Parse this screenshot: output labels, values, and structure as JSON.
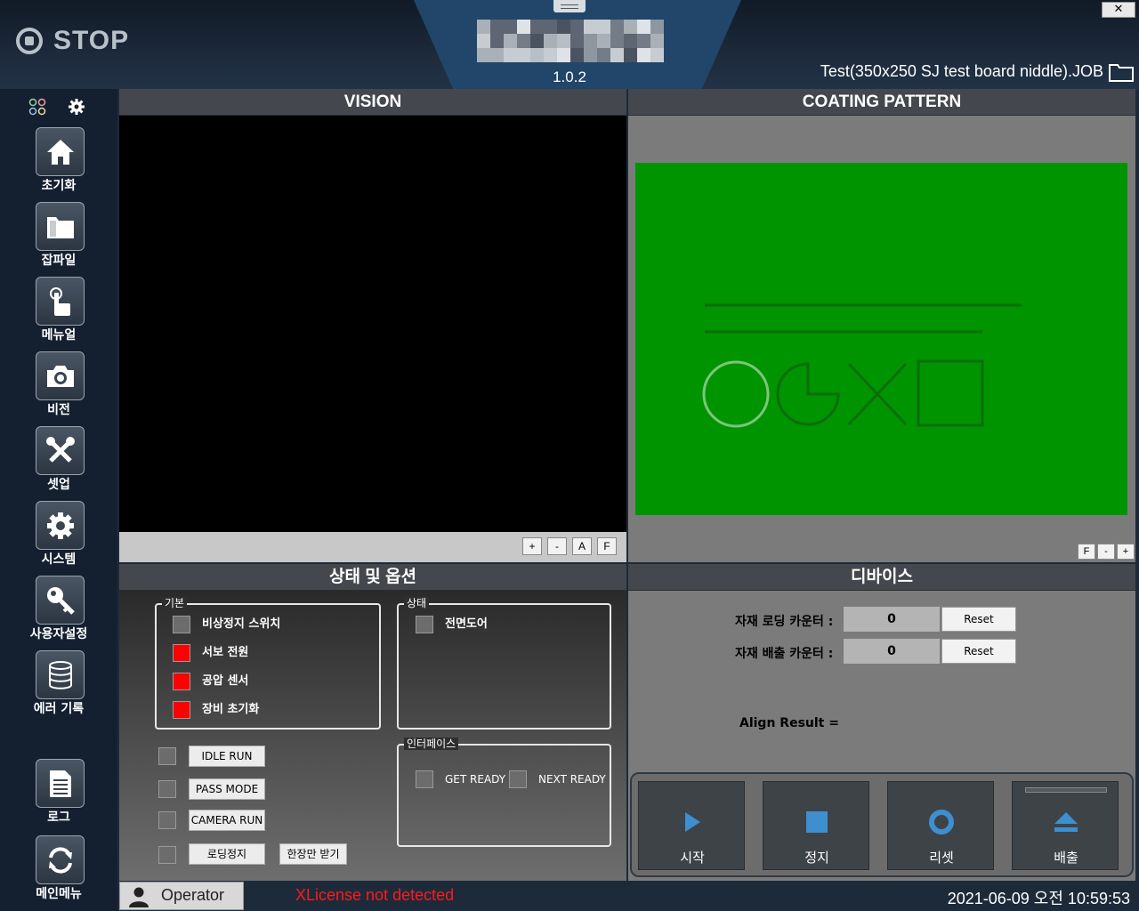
{
  "header": {
    "machine_state": "STOP",
    "version": "1.0.2",
    "job_file": "Test(350x250 SJ test board niddle).JOB",
    "close_label": "✕"
  },
  "sidebar": {
    "items": [
      {
        "label": "초기화",
        "icon": "home-icon"
      },
      {
        "label": "잡파일",
        "icon": "folder-icon"
      },
      {
        "label": "메뉴얼",
        "icon": "hand-pointer-icon"
      },
      {
        "label": "비전",
        "icon": "camera-icon"
      },
      {
        "label": "셋업",
        "icon": "tools-icon"
      },
      {
        "label": "시스템",
        "icon": "gear-icon"
      },
      {
        "label": "사용자설정",
        "icon": "key-icon"
      },
      {
        "label": "에러 기록",
        "icon": "database-icon"
      },
      {
        "label": "로그",
        "icon": "document-icon"
      },
      {
        "label": "메인메뉴",
        "icon": "refresh-icon"
      }
    ]
  },
  "vision": {
    "title": "VISION",
    "controls": [
      "+",
      "-",
      "A",
      "F"
    ]
  },
  "coating": {
    "title": "COATING PATTERN",
    "controls": [
      "F",
      "-",
      "+"
    ],
    "board_color": "#009400"
  },
  "status": {
    "title": "상태 및 옵션",
    "basic": {
      "title": "기본",
      "items": [
        {
          "label": "비상정지 스위치",
          "state": "gray"
        },
        {
          "label": "서보 전원",
          "state": "red"
        },
        {
          "label": "공압 센서",
          "state": "red"
        },
        {
          "label": "장비 초기화",
          "state": "red"
        }
      ]
    },
    "state": {
      "title": "상태",
      "items": [
        {
          "label": "전면도어",
          "state": "gray"
        }
      ]
    },
    "interface": {
      "title": "인터페이스",
      "items": [
        {
          "label": "GET READY",
          "state": "gray"
        },
        {
          "label": "NEXT READY",
          "state": "gray"
        }
      ]
    },
    "options": [
      {
        "label": "IDLE RUN"
      },
      {
        "label": "PASS MODE"
      },
      {
        "label": "CAMERA RUN"
      },
      {
        "label": "로딩정지"
      }
    ],
    "single_receive_label": "한장만 받기"
  },
  "device": {
    "title": "디바이스",
    "loading_counter_label": "자재 로딩 카운터 :",
    "loading_counter_value": "0",
    "unloading_counter_label": "자재 배출 카운터 :",
    "unloading_counter_value": "0",
    "reset_label": "Reset",
    "align_result_label": "Align Result ="
  },
  "actions": [
    {
      "label": "시작",
      "icon": "play-icon"
    },
    {
      "label": "정지",
      "icon": "stop-icon"
    },
    {
      "label": "리셋",
      "icon": "reset-circle-icon"
    },
    {
      "label": "배출",
      "icon": "eject-icon"
    }
  ],
  "footer": {
    "operator": "Operator",
    "license_warning": "XLicense not detected",
    "datetime": "2021-06-09 오전 10:59:53"
  },
  "colors": {
    "status_red": "#ff0000",
    "status_gray": "#6c6c6c",
    "header_blue": "#21466a",
    "license_warning": "#ff1a1a"
  }
}
